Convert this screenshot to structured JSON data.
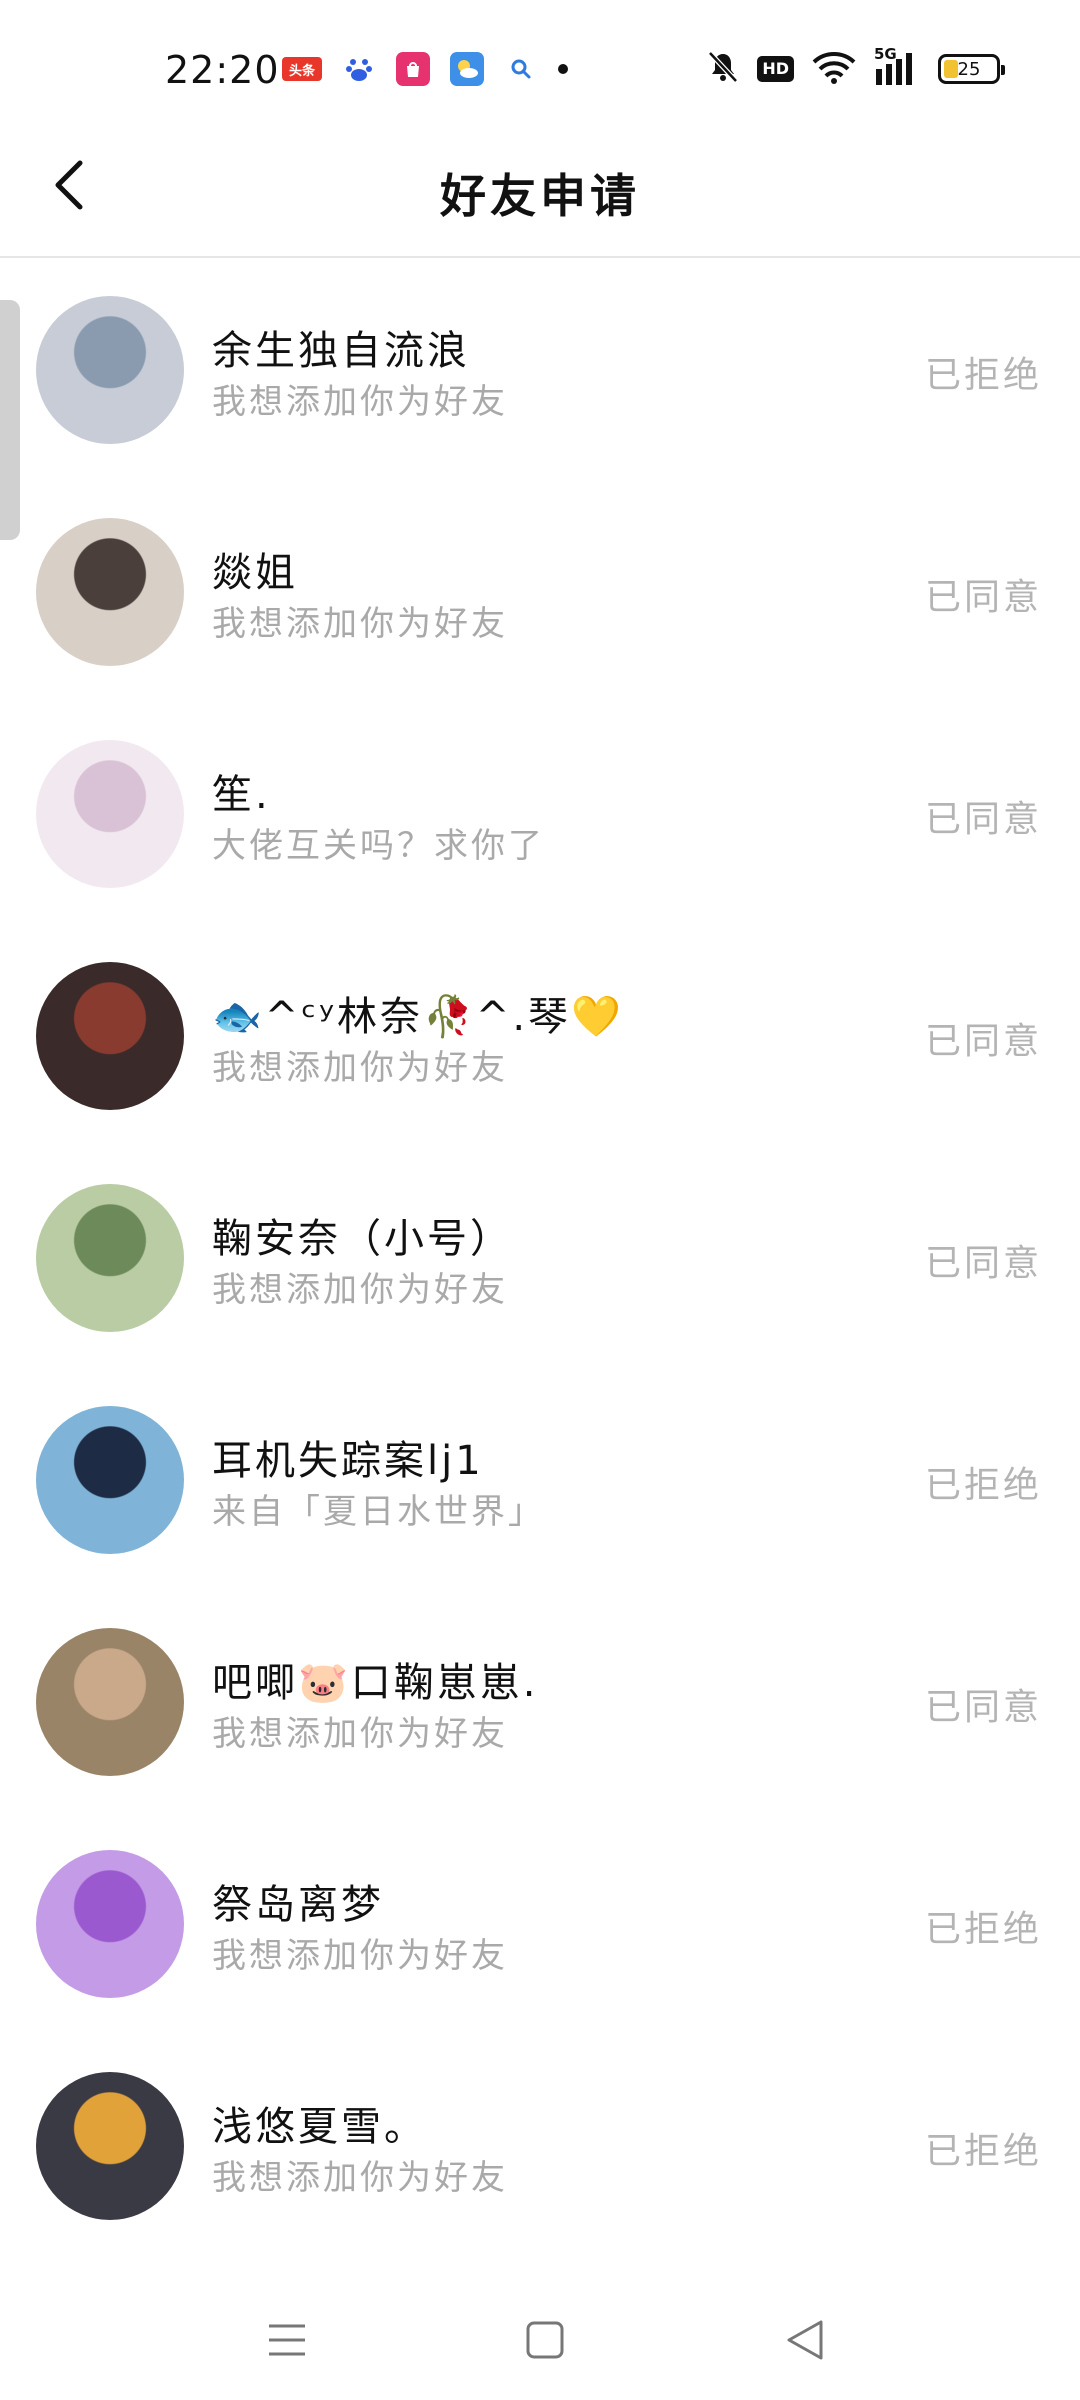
{
  "status_bar": {
    "time": "22:20",
    "notification_icons": [
      "toutiao-icon",
      "baidu-icon",
      "shop-app-icon",
      "weather-icon",
      "search-app-icon"
    ],
    "toutiao_label": "头条",
    "hd_label": "HD",
    "network_label": "5G",
    "battery_level": "25"
  },
  "header": {
    "title": "好友申请"
  },
  "requests": [
    {
      "name": "余生独自流浪",
      "message": "我想添加你为好友",
      "status": "已拒绝",
      "avatar_color": "#8a9bb0",
      "avatar_bg": "#c7ccd6"
    },
    {
      "name": "燚姐",
      "message": "我想添加你为好友",
      "status": "已同意",
      "avatar_color": "#4a3f3b",
      "avatar_bg": "#d8cfc7"
    },
    {
      "name": "笙.",
      "message": "大佬互关吗？求你了",
      "status": "已同意",
      "avatar_color": "#d9c2d6",
      "avatar_bg": "#f2e9f0"
    },
    {
      "name": "🐟^ᶜʸ林奈🥀^.琴💛",
      "message": "我想添加你为好友",
      "status": "已同意",
      "avatar_color": "#8a3b2f",
      "avatar_bg": "#3a2a2a"
    },
    {
      "name": "鞠安奈（小号）",
      "message": "我想添加你为好友",
      "status": "已同意",
      "avatar_color": "#6d8a5b",
      "avatar_bg": "#b9cca4"
    },
    {
      "name": "耳机失踪案lj1",
      "message": "来自「夏日水世界」",
      "status": "已拒绝",
      "avatar_color": "#1d2b44",
      "avatar_bg": "#7fb4d8"
    },
    {
      "name": "吧唧🐷口鞠崽崽.",
      "message": "我想添加你为好友",
      "status": "已同意",
      "avatar_color": "#c9a98a",
      "avatar_bg": "#9a8468"
    },
    {
      "name": "祭岛离梦",
      "message": "我想添加你为好友",
      "status": "已拒绝",
      "avatar_color": "#9b59d0",
      "avatar_bg": "#c49be6"
    },
    {
      "name": "浅悠夏雪。",
      "message": "我想添加你为好友",
      "status": "已拒绝",
      "avatar_color": "#e2a23a",
      "avatar_bg": "#3a3a44"
    }
  ],
  "nav_bar": {
    "icons": [
      "menu-icon",
      "home-icon",
      "back-triangle-icon"
    ]
  }
}
